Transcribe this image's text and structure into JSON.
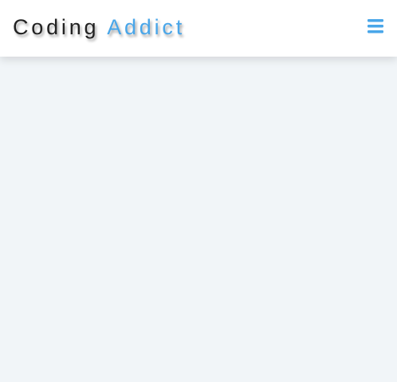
{
  "navbar": {
    "logo": {
      "primary_text": "Coding",
      "accent_text": "Addict",
      "accent_color": "#49a6e9"
    },
    "menu_toggle": {
      "icon": "hamburger-menu-icon",
      "color": "#49a6e9"
    }
  },
  "colors": {
    "page_background": "#f1f5f8",
    "navbar_background": "#ffffff"
  }
}
